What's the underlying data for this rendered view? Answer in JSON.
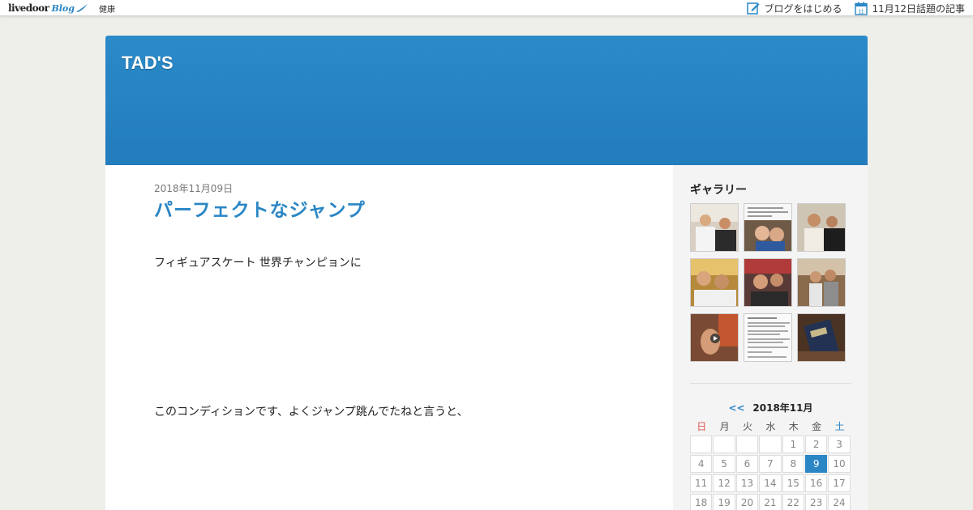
{
  "topbar": {
    "logo_word": "livedoor",
    "logo_blog": "Blog",
    "category": "健康",
    "start_blog": "ブログをはじめる",
    "topic_articles": "11月12日話題の記事",
    "calendar_icon_day": "11"
  },
  "blog": {
    "title": "TAD'S"
  },
  "article": {
    "date": "2018年11月09日",
    "title": "パーフェクトなジャンプ",
    "paragraphs": [
      "フィギュアスケート 世界チャンピョンに",
      "このコンディションです、よくジャンプ跳んでたねと言うと、"
    ]
  },
  "sidebar": {
    "gallery_title": "ギャラリー",
    "gallery_count": 9,
    "calendar": {
      "prev": "<<",
      "month": "2018年11月",
      "weekdays": [
        "日",
        "月",
        "火",
        "水",
        "木",
        "金",
        "土"
      ],
      "weeks": [
        [
          "",
          "",
          "",
          "",
          "1",
          "2",
          "3"
        ],
        [
          "4",
          "5",
          "6",
          "7",
          "8",
          "9",
          "10"
        ],
        [
          "11",
          "12",
          "13",
          "14",
          "15",
          "16",
          "17"
        ],
        [
          "18",
          "19",
          "20",
          "21",
          "22",
          "23",
          "24"
        ]
      ],
      "highlighted_day": "9"
    }
  },
  "colors": {
    "accent": "#2a86c5",
    "header": "#2886c4",
    "sunday": "#e05050"
  }
}
